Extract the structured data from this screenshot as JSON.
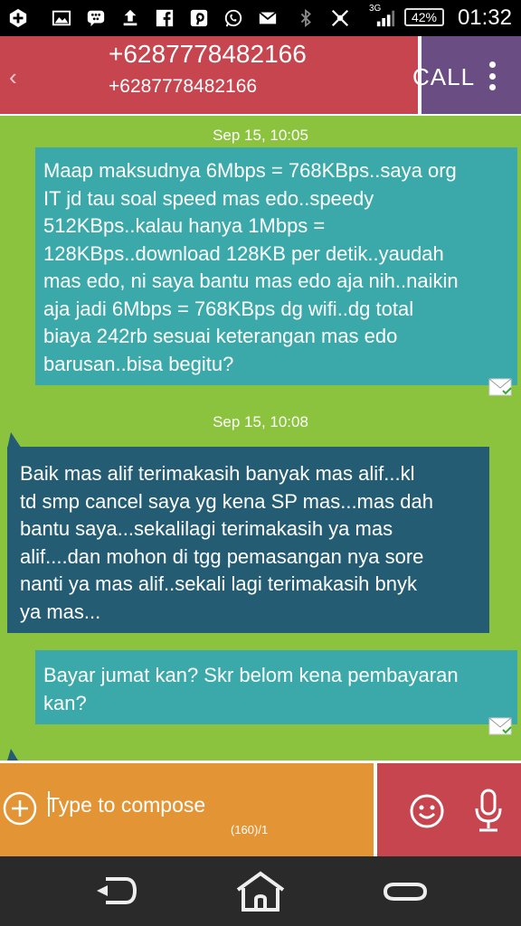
{
  "status_bar": {
    "network": "3G",
    "battery": "42%",
    "time": "01:32",
    "icons": [
      "add-icon",
      "image-icon",
      "bbm-icon",
      "upload-icon",
      "facebook-icon",
      "pinterest-icon",
      "whatsapp-icon",
      "mail-icon",
      "bluetooth-icon",
      "no-signal-icon",
      "signal-icon"
    ]
  },
  "header": {
    "contact_name": "+6287778482166",
    "contact_number": "+6287778482166",
    "call_label": "CALL",
    "back_icon": "chevron-left-icon",
    "menu_icon": "overflow-menu-icon"
  },
  "conversation": {
    "messages": [
      {
        "direction": "outgoing",
        "date": "Sep 15, 10:05",
        "lines": [
          "Maap maksudnya 6Mbps = 768KBps..saya org",
          "IT jd tau soal speed mas edo..speedy",
          "512KBps..kalau hanya 1Mbps =",
          "128KBps..download 128KB per detik..yaudah",
          "mas edo, ni saya bantu mas edo aja nih..naikin",
          "aja jadi 6Mbps = 768KBps dg wifi..dg total",
          "biaya 242rb sesuai keterangan mas edo",
          "barusan..bisa begitu?"
        ],
        "status_icon": "sent-mail-icon"
      },
      {
        "direction": "incoming",
        "date": "Sep 15, 10:08",
        "lines": [
          "Baik mas alif terimakasih banyak mas alif...kl",
          "td smp cancel saya yg kena SP mas...mas dah",
          "bantu saya...sekalilagi terimakasih ya mas",
          "alif....dan mohon di tgg pemasangan nya sore",
          "nanti ya mas alif..sekali lagi terimakasih bnyk",
          "ya mas..."
        ]
      },
      {
        "direction": "outgoing",
        "lines": [
          "Bayar jumat kan? Skr belom kena pembayaran",
          "kan?"
        ],
        "status_icon": "sent-mail-icon"
      }
    ]
  },
  "compose": {
    "placeholder": "Type to compose",
    "counter": "(160)/1",
    "add_icon": "add-attachment-icon",
    "emoji_icon": "smiley-icon",
    "voice_icon": "microphone-icon"
  },
  "navbar": {
    "icons": [
      "back-icon",
      "home-icon",
      "recent-apps-icon"
    ]
  },
  "colors": {
    "header_red": "#c7454f",
    "header_purple": "#6a4d82",
    "conversation_green": "#8bc33f",
    "outgoing_teal": "#3ba9a9",
    "incoming_blue": "#245d73",
    "compose_orange": "#e39536"
  }
}
